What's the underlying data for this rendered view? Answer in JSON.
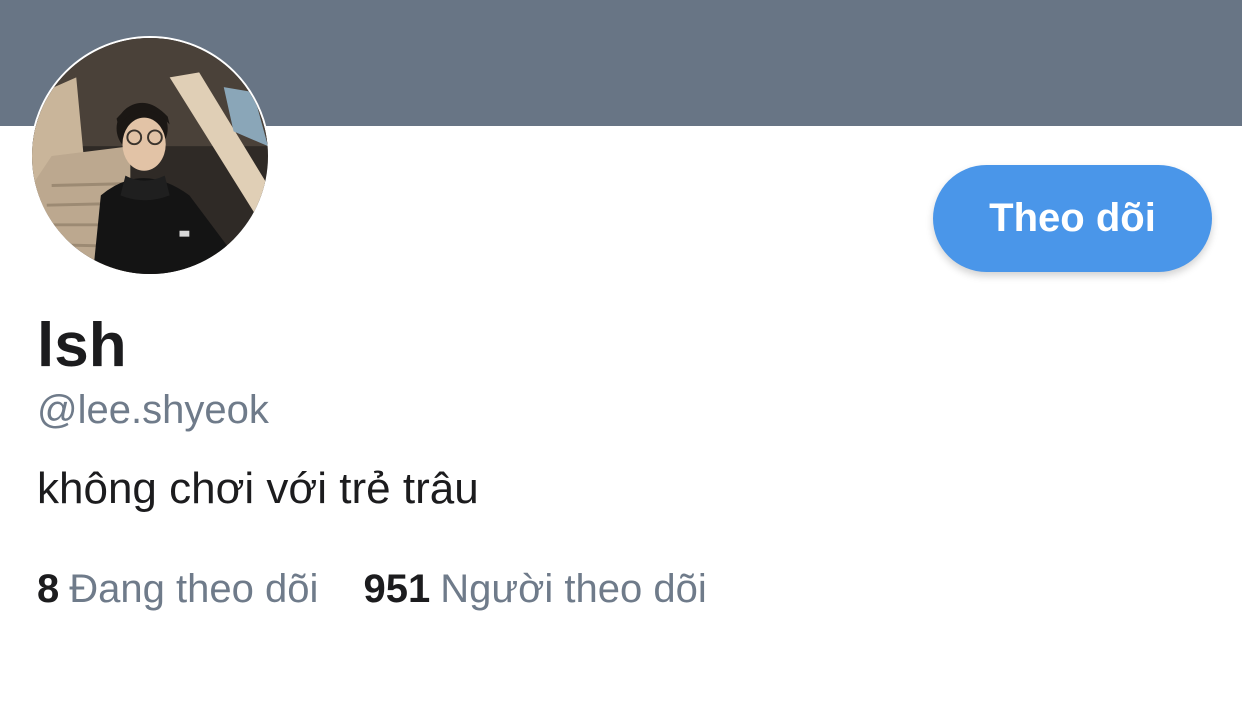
{
  "profile": {
    "display_name": "lsh",
    "handle": "@lee.shyeok",
    "bio": "không chơi với trẻ trâu",
    "follow_button_label": "Theo dõi"
  },
  "stats": {
    "following_count": "8",
    "following_label": "Đang theo dõi",
    "followers_count": "951",
    "followers_label": "Người theo dõi"
  },
  "colors": {
    "banner": "#687585",
    "button": "#4a96e9",
    "secondary_text": "#6f7b8a",
    "primary_text": "#1c1c1e"
  }
}
